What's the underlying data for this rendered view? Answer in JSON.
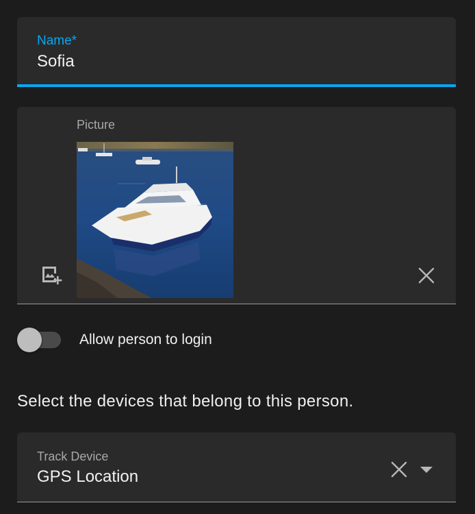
{
  "name_field": {
    "label": "Name*",
    "value": "Sofia"
  },
  "picture": {
    "label": "Picture",
    "alt": "Motor yacht on calm water",
    "add_icon": "add-photo-icon",
    "clear_icon": "close-icon"
  },
  "login_toggle": {
    "label": "Allow person to login",
    "checked": false
  },
  "devices": {
    "heading": "Select the devices that belong to this person.",
    "track_device": {
      "label": "Track Device",
      "value": "GPS Location",
      "clear_icon": "close-icon",
      "dropdown_icon": "caret-down-icon"
    }
  },
  "colors": {
    "background": "#1c1c1c",
    "field_background": "#2a2a2a",
    "accent": "#03a9f4",
    "secondary_text": "#a8a8a8"
  }
}
